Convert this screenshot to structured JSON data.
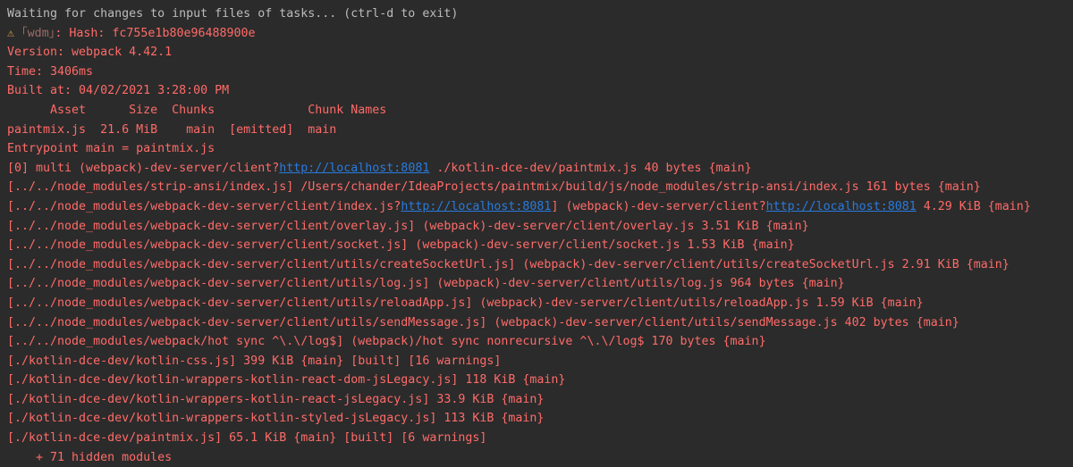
{
  "terminal": {
    "colors": {
      "background": "#2b2b2b",
      "text_default": "#bbbbbb",
      "text_error": "#ff6b68",
      "link": "#287bde",
      "warning_icon": "#d9a343"
    },
    "lines": [
      {
        "style": "neutral",
        "segments": [
          {
            "t": "Waiting for changes to input files of tasks... (ctrl-d to exit)"
          }
        ]
      },
      {
        "style": "error",
        "segments": [
          {
            "t": "⚠",
            "k": "warn-icon",
            "icon": "warning-icon"
          },
          {
            "t": " "
          },
          {
            "t": "｢wdm｣",
            "k": "dim"
          },
          {
            "t": ": Hash: fc755e1b80e96488900e"
          }
        ]
      },
      {
        "style": "error",
        "segments": [
          {
            "t": "Version: webpack 4.42.1"
          }
        ]
      },
      {
        "style": "error",
        "segments": [
          {
            "t": "Time: 3406ms"
          }
        ]
      },
      {
        "style": "error",
        "segments": [
          {
            "t": "Built at: 04/02/2021 3:28:00 PM"
          }
        ]
      },
      {
        "style": "error",
        "segments": [
          {
            "t": "      Asset      Size  Chunks             Chunk Names"
          }
        ]
      },
      {
        "style": "error",
        "segments": [
          {
            "t": "paintmix.js  21.6 MiB    main  [emitted]  main"
          }
        ]
      },
      {
        "style": "error",
        "segments": [
          {
            "t": "Entrypoint main = paintmix.js"
          }
        ]
      },
      {
        "style": "error",
        "segments": [
          {
            "t": "[0] multi (webpack)-dev-server/client?"
          },
          {
            "t": "http://localhost:8081",
            "k": "link"
          },
          {
            "t": " ./kotlin-dce-dev/paintmix.js 40 bytes {main}"
          }
        ]
      },
      {
        "style": "error",
        "segments": [
          {
            "t": "[../../node_modules/strip-ansi/index.js] /Users/chander/IdeaProjects/paintmix/build/js/node_modules/strip-ansi/index.js 161 bytes {main}"
          }
        ]
      },
      {
        "style": "error",
        "segments": [
          {
            "t": "[../../node_modules/webpack-dev-server/client/index.js?"
          },
          {
            "t": "http://localhost:8081",
            "k": "link"
          },
          {
            "t": "] (webpack)-dev-server/client?"
          },
          {
            "t": "http://localhost:8081",
            "k": "link"
          },
          {
            "t": " 4.29 KiB {main}"
          }
        ]
      },
      {
        "style": "error",
        "segments": [
          {
            "t": "[../../node_modules/webpack-dev-server/client/overlay.js] (webpack)-dev-server/client/overlay.js 3.51 KiB {main}"
          }
        ]
      },
      {
        "style": "error",
        "segments": [
          {
            "t": "[../../node_modules/webpack-dev-server/client/socket.js] (webpack)-dev-server/client/socket.js 1.53 KiB {main}"
          }
        ]
      },
      {
        "style": "error",
        "segments": [
          {
            "t": "[../../node_modules/webpack-dev-server/client/utils/createSocketUrl.js] (webpack)-dev-server/client/utils/createSocketUrl.js 2.91 KiB {main}"
          }
        ]
      },
      {
        "style": "error",
        "segments": [
          {
            "t": "[../../node_modules/webpack-dev-server/client/utils/log.js] (webpack)-dev-server/client/utils/log.js 964 bytes {main}"
          }
        ]
      },
      {
        "style": "error",
        "segments": [
          {
            "t": "[../../node_modules/webpack-dev-server/client/utils/reloadApp.js] (webpack)-dev-server/client/utils/reloadApp.js 1.59 KiB {main}"
          }
        ]
      },
      {
        "style": "error",
        "segments": [
          {
            "t": "[../../node_modules/webpack-dev-server/client/utils/sendMessage.js] (webpack)-dev-server/client/utils/sendMessage.js 402 bytes {main}"
          }
        ]
      },
      {
        "style": "error",
        "segments": [
          {
            "t": "[../../node_modules/webpack/hot sync ^\\.\\/log$] (webpack)/hot sync nonrecursive ^\\.\\/log$ 170 bytes {main}"
          }
        ]
      },
      {
        "style": "error",
        "segments": [
          {
            "t": "[./kotlin-dce-dev/kotlin-css.js] 399 KiB {main} [built] [16 warnings]"
          }
        ]
      },
      {
        "style": "error",
        "segments": [
          {
            "t": "[./kotlin-dce-dev/kotlin-wrappers-kotlin-react-dom-jsLegacy.js] 118 KiB {main}"
          }
        ]
      },
      {
        "style": "error",
        "segments": [
          {
            "t": "[./kotlin-dce-dev/kotlin-wrappers-kotlin-react-jsLegacy.js] 33.9 KiB {main}"
          }
        ]
      },
      {
        "style": "error",
        "segments": [
          {
            "t": "[./kotlin-dce-dev/kotlin-wrappers-kotlin-styled-jsLegacy.js] 113 KiB {main}"
          }
        ]
      },
      {
        "style": "error",
        "segments": [
          {
            "t": "[./kotlin-dce-dev/paintmix.js] 65.1 KiB {main} [built] [6 warnings]"
          }
        ]
      },
      {
        "style": "error",
        "segments": [
          {
            "t": "    + 71 hidden modules"
          }
        ]
      }
    ]
  }
}
